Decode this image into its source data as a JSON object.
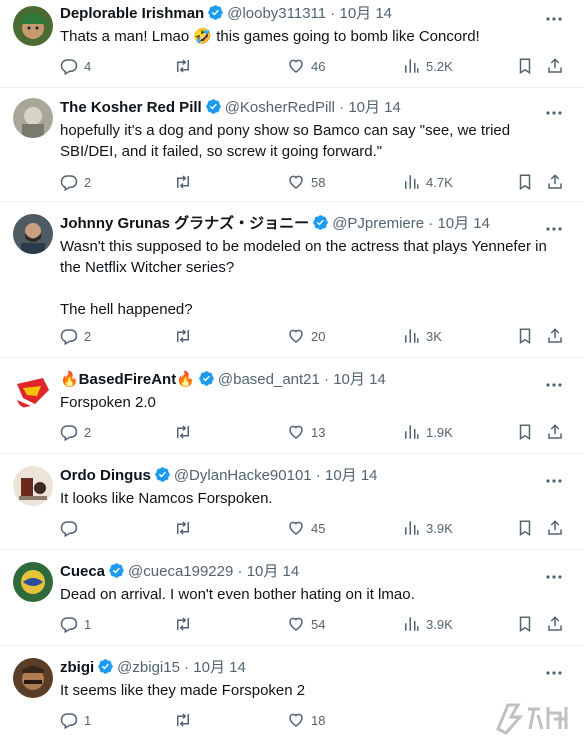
{
  "tweets": [
    {
      "name": "Deplorable Irishman",
      "handle": "@looby311311",
      "date": "10月 14",
      "text": "Thats a man! Lmao 🤣 this games going to bomb like Concord!",
      "replies": "4",
      "retweets": "",
      "likes": "46",
      "views": "5.2K",
      "avatar_color": "#3d5a2a"
    },
    {
      "name": "The Kosher Red Pill",
      "handle": "@KosherRedPill",
      "date": "10月 14",
      "text": "hopefully it's a dog and pony show so Bamco can say \"see, we tried SBI/DEI, and it failed, so screw it going forward.\"",
      "replies": "2",
      "retweets": "",
      "likes": "58",
      "views": "4.7K",
      "avatar_color": "#9a9a8e"
    },
    {
      "name": "Johnny Grunas グラナズ・ジョニー",
      "handle": "@PJpremiere",
      "date": "10月 14",
      "text": "Wasn't this supposed to be modeled on the actress that plays Yennefer in the Netflix Witcher series?\n\nThe hell happened?",
      "replies": "2",
      "retweets": "",
      "likes": "20",
      "views": "3K",
      "avatar_color": "#5b6770"
    },
    {
      "name": "🔥BasedFireAnt🔥",
      "handle": "@based_ant21",
      "date": "10月 14",
      "text": "Forspoken 2.0",
      "replies": "2",
      "retweets": "",
      "likes": "13",
      "views": "1.9K",
      "avatar_color": "#ffffff"
    },
    {
      "name": "Ordo Dingus",
      "handle": "@DylanHacke90101",
      "date": "10月 14",
      "text": "It looks like Namcos Forspoken.",
      "replies": "",
      "retweets": "",
      "likes": "45",
      "views": "3.9K",
      "avatar_color": "#e8e0d6"
    },
    {
      "name": "Cueca",
      "handle": "@cueca199229",
      "date": "10月 14",
      "text": "Dead on arrival. I won't even bother hating on it lmao.",
      "replies": "1",
      "retweets": "",
      "likes": "54",
      "views": "3.9K",
      "avatar_color": "#2f6b3a"
    },
    {
      "name": "zbigi",
      "handle": "@zbigi15",
      "date": "10月 14",
      "text": "It seems like they made Forspoken 2",
      "replies": "1",
      "retweets": "",
      "likes": "18",
      "views": "",
      "avatar_color": "#6b4a2e"
    }
  ],
  "colors": {
    "text": "#0f1419",
    "meta": "#536471",
    "verified": "#1d9bf0",
    "divider": "#eff3f4"
  },
  "icons": [
    "reply-icon",
    "retweet-icon",
    "like-icon",
    "views-icon",
    "bookmark-icon",
    "share-icon",
    "more-icon",
    "verified-badge-icon"
  ]
}
